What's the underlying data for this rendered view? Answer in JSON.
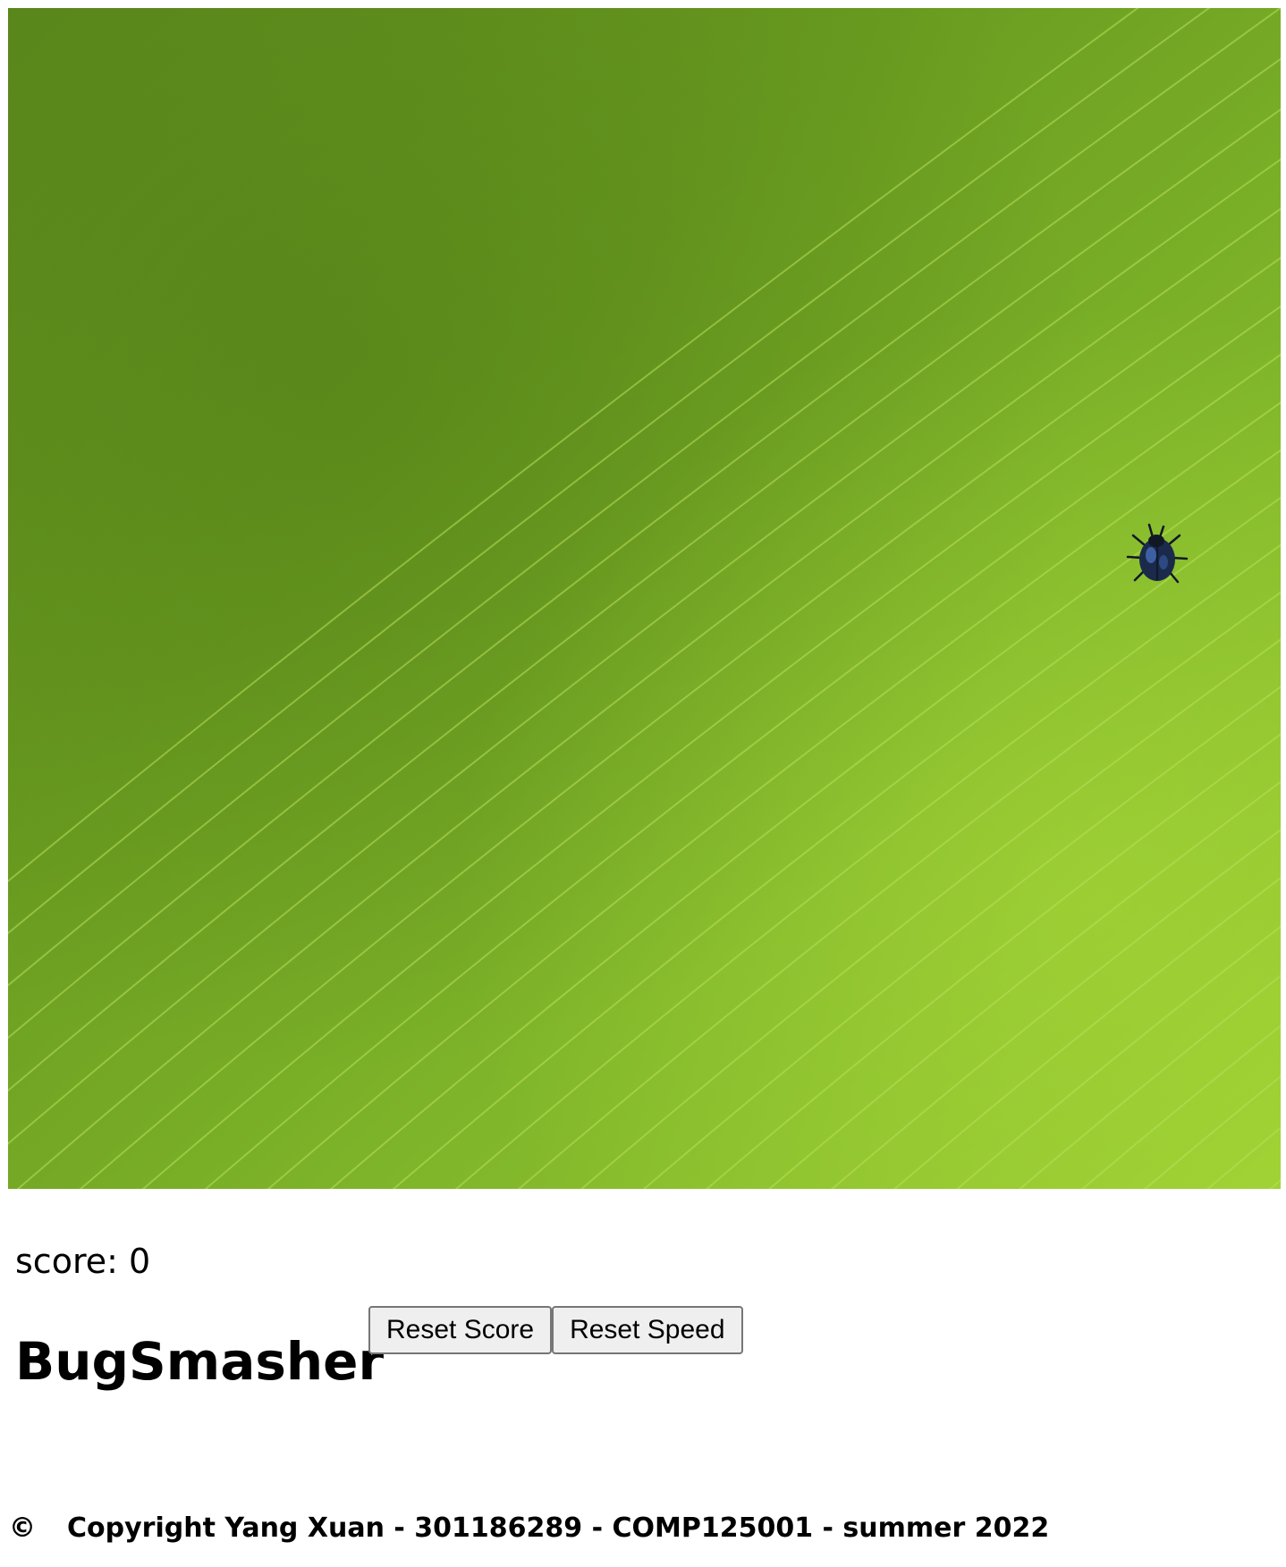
{
  "game": {
    "background": "green-leaf-texture",
    "sprite": "bug-icon",
    "colors": {
      "leaf_dark": "#5c8a1c",
      "leaf_mid": "#74aa24",
      "leaf_light": "#9ccf33",
      "bug_body": "#1b2a4a",
      "bug_highlight": "#4a78c8"
    }
  },
  "score": {
    "text": "score: 0"
  },
  "title": "BugSmasher",
  "buttons": {
    "reset_score": "Reset Score",
    "reset_speed": "Reset Speed"
  },
  "footer": {
    "symbol": "©",
    "text": "Copyright Yang Xuan - 301186289 - COMP125001 - summer 2022"
  }
}
